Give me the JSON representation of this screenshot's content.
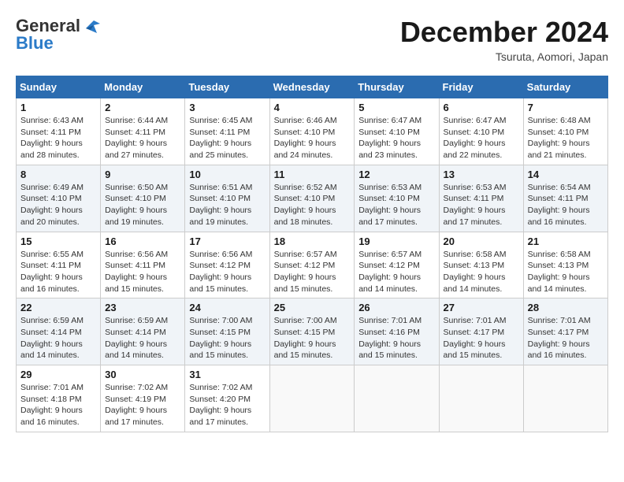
{
  "header": {
    "logo_line1": "General",
    "logo_line2": "Blue",
    "month": "December 2024",
    "location": "Tsuruta, Aomori, Japan"
  },
  "days_of_week": [
    "Sunday",
    "Monday",
    "Tuesday",
    "Wednesday",
    "Thursday",
    "Friday",
    "Saturday"
  ],
  "weeks": [
    [
      {
        "day": 1,
        "sunrise": "6:43 AM",
        "sunset": "4:11 PM",
        "daylight": "9 hours and 28 minutes."
      },
      {
        "day": 2,
        "sunrise": "6:44 AM",
        "sunset": "4:11 PM",
        "daylight": "9 hours and 27 minutes."
      },
      {
        "day": 3,
        "sunrise": "6:45 AM",
        "sunset": "4:11 PM",
        "daylight": "9 hours and 25 minutes."
      },
      {
        "day": 4,
        "sunrise": "6:46 AM",
        "sunset": "4:10 PM",
        "daylight": "9 hours and 24 minutes."
      },
      {
        "day": 5,
        "sunrise": "6:47 AM",
        "sunset": "4:10 PM",
        "daylight": "9 hours and 23 minutes."
      },
      {
        "day": 6,
        "sunrise": "6:47 AM",
        "sunset": "4:10 PM",
        "daylight": "9 hours and 22 minutes."
      },
      {
        "day": 7,
        "sunrise": "6:48 AM",
        "sunset": "4:10 PM",
        "daylight": "9 hours and 21 minutes."
      }
    ],
    [
      {
        "day": 8,
        "sunrise": "6:49 AM",
        "sunset": "4:10 PM",
        "daylight": "9 hours and 20 minutes."
      },
      {
        "day": 9,
        "sunrise": "6:50 AM",
        "sunset": "4:10 PM",
        "daylight": "9 hours and 19 minutes."
      },
      {
        "day": 10,
        "sunrise": "6:51 AM",
        "sunset": "4:10 PM",
        "daylight": "9 hours and 19 minutes."
      },
      {
        "day": 11,
        "sunrise": "6:52 AM",
        "sunset": "4:10 PM",
        "daylight": "9 hours and 18 minutes."
      },
      {
        "day": 12,
        "sunrise": "6:53 AM",
        "sunset": "4:10 PM",
        "daylight": "9 hours and 17 minutes."
      },
      {
        "day": 13,
        "sunrise": "6:53 AM",
        "sunset": "4:11 PM",
        "daylight": "9 hours and 17 minutes."
      },
      {
        "day": 14,
        "sunrise": "6:54 AM",
        "sunset": "4:11 PM",
        "daylight": "9 hours and 16 minutes."
      }
    ],
    [
      {
        "day": 15,
        "sunrise": "6:55 AM",
        "sunset": "4:11 PM",
        "daylight": "9 hours and 16 minutes."
      },
      {
        "day": 16,
        "sunrise": "6:56 AM",
        "sunset": "4:11 PM",
        "daylight": "9 hours and 15 minutes."
      },
      {
        "day": 17,
        "sunrise": "6:56 AM",
        "sunset": "4:12 PM",
        "daylight": "9 hours and 15 minutes."
      },
      {
        "day": 18,
        "sunrise": "6:57 AM",
        "sunset": "4:12 PM",
        "daylight": "9 hours and 15 minutes."
      },
      {
        "day": 19,
        "sunrise": "6:57 AM",
        "sunset": "4:12 PM",
        "daylight": "9 hours and 14 minutes."
      },
      {
        "day": 20,
        "sunrise": "6:58 AM",
        "sunset": "4:13 PM",
        "daylight": "9 hours and 14 minutes."
      },
      {
        "day": 21,
        "sunrise": "6:58 AM",
        "sunset": "4:13 PM",
        "daylight": "9 hours and 14 minutes."
      }
    ],
    [
      {
        "day": 22,
        "sunrise": "6:59 AM",
        "sunset": "4:14 PM",
        "daylight": "9 hours and 14 minutes."
      },
      {
        "day": 23,
        "sunrise": "6:59 AM",
        "sunset": "4:14 PM",
        "daylight": "9 hours and 14 minutes."
      },
      {
        "day": 24,
        "sunrise": "7:00 AM",
        "sunset": "4:15 PM",
        "daylight": "9 hours and 15 minutes."
      },
      {
        "day": 25,
        "sunrise": "7:00 AM",
        "sunset": "4:15 PM",
        "daylight": "9 hours and 15 minutes."
      },
      {
        "day": 26,
        "sunrise": "7:01 AM",
        "sunset": "4:16 PM",
        "daylight": "9 hours and 15 minutes."
      },
      {
        "day": 27,
        "sunrise": "7:01 AM",
        "sunset": "4:17 PM",
        "daylight": "9 hours and 15 minutes."
      },
      {
        "day": 28,
        "sunrise": "7:01 AM",
        "sunset": "4:17 PM",
        "daylight": "9 hours and 16 minutes."
      }
    ],
    [
      {
        "day": 29,
        "sunrise": "7:01 AM",
        "sunset": "4:18 PM",
        "daylight": "9 hours and 16 minutes."
      },
      {
        "day": 30,
        "sunrise": "7:02 AM",
        "sunset": "4:19 PM",
        "daylight": "9 hours and 17 minutes."
      },
      {
        "day": 31,
        "sunrise": "7:02 AM",
        "sunset": "4:20 PM",
        "daylight": "9 hours and 17 minutes."
      },
      null,
      null,
      null,
      null
    ]
  ],
  "labels": {
    "sunrise": "Sunrise:",
    "sunset": "Sunset:",
    "daylight": "Daylight:"
  }
}
